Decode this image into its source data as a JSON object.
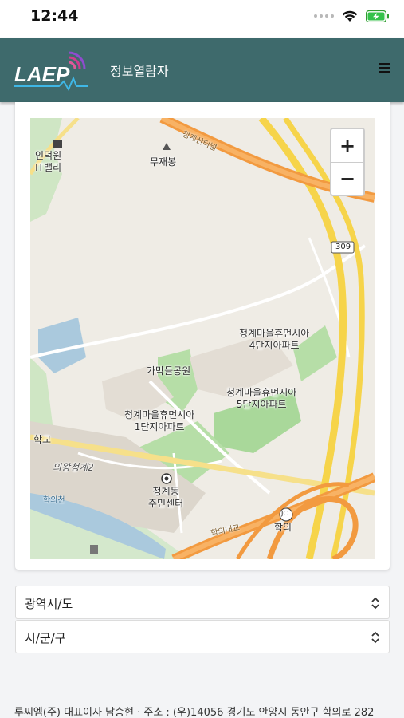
{
  "status_bar": {
    "time": "12:44"
  },
  "header": {
    "brand": "LAEP",
    "title": "정보열람자"
  },
  "map": {
    "zoom_in": "+",
    "zoom_out": "−",
    "labels": {
      "indeogwon": "인덕원\nIT밸리",
      "mujaebong": "무재봉",
      "apt4": "청계마을휴먼시아\n4단지아파트",
      "gamakdeul": "가막들공원",
      "apt5": "청계마을휴먼시아\n5단지아파트",
      "apt1": "청계마을휴먼시아\n1단지아파트",
      "school": "학교",
      "uiwang": "의왕청계2",
      "hakuicheon": "학의천",
      "center": "청계동\n주민센터",
      "hakuidaegyo": "학의대교",
      "hakui": "학의",
      "jc": "JC",
      "route309": "309",
      "cheonggye": "청계산터널"
    }
  },
  "selects": {
    "province": "광역시/도",
    "city": "시/군/구"
  },
  "footer": {
    "text": "루씨엠(주) 대표이사 남승현 · 주소 : (우)14056 경기도 안양시 동안구 학의로 282"
  }
}
